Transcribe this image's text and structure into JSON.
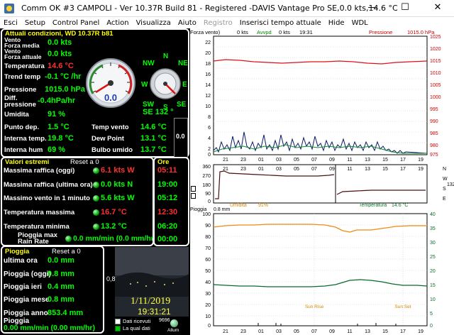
{
  "window": {
    "title": "Comm OK #3 CAMPOLI - Ver 10.37R Build 81 - Registered  -DAVIS Vantage Pro  SE,0.0 kts,14.6 °C",
    "minimize": "—",
    "maximize": "☐",
    "close": "✕"
  },
  "menu": [
    "Esci",
    "Setup",
    "Control Panel",
    "Action",
    "Visualizza",
    "Aiuto",
    "Registro",
    "Inserisci tempo attuale",
    "Hide",
    "WDL"
  ],
  "current": {
    "header": "Attuali condizioni, WD 10.37R b81",
    "wind_avg_label": "Vento\nForza media",
    "wind_avg": "0.0 kts",
    "wind_now_label": "Vento\nForza attuale",
    "wind_now": "0.0 kts",
    "temp_label": "Temperatura",
    "temp": "14.6 °C",
    "trend_label": "Trend temp",
    "trend": "-0.1 °C /hr",
    "pressure_label": "Pressione",
    "pressure": "1015.0 hPa",
    "diff_label": "Diff.\npressione",
    "diff": "-0.4hPa/hr",
    "humidity_label": "Umidita",
    "humidity": "91 %",
    "dew_label": "Punto dep.",
    "dew": "1.5 °C",
    "intemp_label": "Interna temp.",
    "intemp": "19.8 °C",
    "inhum_label": "Interna hum",
    "inhum": "69 %",
    "windchill_label": "Temp vento",
    "windchill": "14.6 °C",
    "dewpoint_label": "Dew Point",
    "dewpoint": "13.1 °C",
    "wetbulb_label": "Bulbo umido",
    "wetbulb": "13.7 °C",
    "direction": "SE  132 °",
    "gauge_value": "0.0",
    "compass": {
      "N": "N",
      "NE": "NE",
      "E": "E",
      "SE": "SE",
      "S": "S",
      "SW": "SW",
      "W": "W",
      "NW": "NW"
    },
    "side_value": "0.0"
  },
  "extremes": {
    "header": "Valori estremi",
    "reset": "Reset a 0",
    "ore_header": "Ore",
    "rows": [
      {
        "label": "Massima raffica (oggi)",
        "value": "6.1 kts W",
        "time": "05:11",
        "value_color": "#ff3030",
        "time_color": "#ff3030"
      },
      {
        "label": "Massima raffica (ultima ora)",
        "value": "0.0 kts  N",
        "time": "19:00",
        "value_color": "#00ff00",
        "time_color": "#00ff00"
      },
      {
        "label": "Massimo vento in 1 minuto",
        "value": "5.6 kts W",
        "time": "05:12",
        "value_color": "#00ff00",
        "time_color": "#00ff00"
      },
      {
        "label": "Temperatura massima",
        "value": "16.7 °C",
        "time": "12:30",
        "value_color": "#ff3030",
        "time_color": "#ff3030"
      },
      {
        "label": "Temperatura minima",
        "value": "13.2 °C",
        "time": "06:20",
        "value_color": "#00ff00",
        "time_color": "#00ff00"
      },
      {
        "label": "Pioggia max\nRain Rate",
        "value": "0.0 mm/min (0.0 mm/hr)",
        "time": "00:00",
        "value_color": "#00ff00",
        "time_color": "#00ff00"
      }
    ]
  },
  "rain": {
    "header": "Pioggia",
    "reset": "Reset a 0",
    "rows": [
      {
        "label": "ultima ora",
        "value": "0.0 mm"
      },
      {
        "label": "Pioggia (oggi)",
        "value": "0.8 mm"
      },
      {
        "label": "Pioggia ieri",
        "value": "0.4 mm"
      },
      {
        "label": "Pioggia mese",
        "value": "0.8 mm"
      },
      {
        "label": "Pioggia anno",
        "value": "853.4 mm"
      }
    ],
    "rate_label": "Pioggia",
    "rate": "0.00 mm/min (0.00 mm/hr)"
  },
  "camera": {
    "date": "1/11/2019",
    "time": "19:31:21",
    "side_value": "0,8",
    "rx_label": "Dati ricevuti",
    "rx_count": "9696",
    "quality_label": "La qual dati",
    "alarm_label": "Allum"
  },
  "charts": {
    "wind": {
      "label": "Forza vento)",
      "v1": "0 kts",
      "avg_label": "Avvpd",
      "v2": "0 kts",
      "time": "19:31",
      "pressure_label": "Pressione",
      "pressure": "1015.0 hPa",
      "left_ticks": [
        "22",
        "20",
        "18",
        "16",
        "14",
        "12",
        "10",
        "8",
        "6",
        "4",
        "2",
        "0"
      ],
      "right_ticks": [
        "1025",
        "1020",
        "1015",
        "1010",
        "1005",
        "1000",
        "995",
        "990",
        "985",
        "980",
        "975"
      ],
      "x_ticks": [
        "21",
        "23",
        "01",
        "03",
        "05",
        "07",
        "09",
        "11",
        "13",
        "15",
        "17",
        "19"
      ]
    },
    "direction": {
      "left_ticks": [
        "360",
        "270",
        "180",
        "90",
        "0"
      ],
      "x_ticks": [
        "21",
        "23",
        "01",
        "03",
        "05",
        "07",
        "09",
        "11",
        "13",
        "15",
        "17",
        "19"
      ],
      "side_letters": [
        "N",
        "W",
        "S",
        "E"
      ],
      "side_value": "132",
      "humidity_label": "Umidita",
      "humidity": "91%",
      "temp_label": "Temperatura",
      "temp": "14.6 °C"
    },
    "temperature": {
      "rain_label": "Pioggia",
      "rain": "0.8 mm",
      "left_ticks": [
        "100",
        "90",
        "80",
        "70",
        "60",
        "50",
        "40",
        "30",
        "20",
        "10",
        "0"
      ],
      "right_ticks": [
        "40",
        "35",
        "30",
        "25",
        "20",
        "15",
        "10",
        "5",
        "0"
      ],
      "x_ticks": [
        "21",
        "23",
        "01",
        "03",
        "05",
        "07",
        "09",
        "11",
        "13",
        "15",
        "17",
        "19"
      ],
      "sunrise": "Sun Rise",
      "sunset": "Sun Set"
    }
  }
}
